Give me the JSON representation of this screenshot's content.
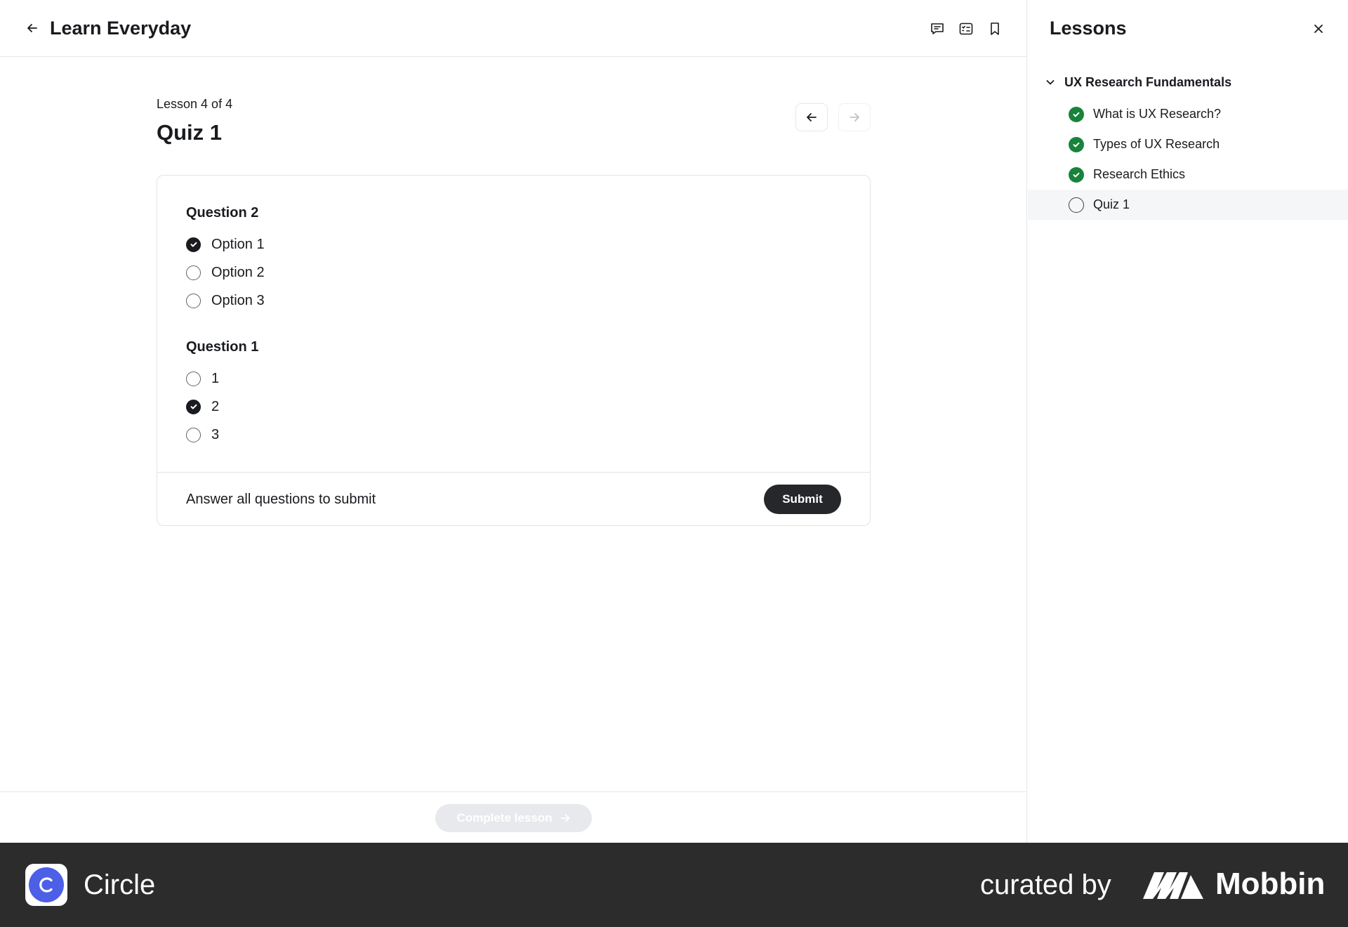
{
  "header": {
    "title": "Learn Everyday",
    "icons": [
      "back-arrow-icon",
      "comments-icon",
      "lesson-list-icon",
      "bookmark-icon"
    ]
  },
  "lesson": {
    "count_label": "Lesson 4 of 4",
    "title": "Quiz 1"
  },
  "quiz": {
    "questions": [
      {
        "title": "Question 2",
        "options": [
          {
            "label": "Option 1",
            "checked": true
          },
          {
            "label": "Option 2",
            "checked": false
          },
          {
            "label": "Option 3",
            "checked": false
          }
        ]
      },
      {
        "title": "Question 1",
        "options": [
          {
            "label": "1",
            "checked": false
          },
          {
            "label": "2",
            "checked": true
          },
          {
            "label": "3",
            "checked": false
          }
        ]
      }
    ],
    "footer_note": "Answer all questions to submit",
    "submit_label": "Submit"
  },
  "bottom": {
    "complete_label": "Complete lesson",
    "complete_enabled": false
  },
  "sidebar": {
    "title": "Lessons",
    "section": "UX Research Fundamentals",
    "lessons": [
      {
        "label": "What is UX Research?",
        "completed": true
      },
      {
        "label": "Types of UX Research",
        "completed": true
      },
      {
        "label": "Research Ethics",
        "completed": true
      },
      {
        "label": "Quiz 1",
        "completed": false,
        "active": true
      }
    ]
  },
  "branding": {
    "app_name": "Circle",
    "curated_by": "curated by",
    "curator": "Mobbin"
  },
  "colors": {
    "accent_dark": "#25272b",
    "completed_green": "#18833a",
    "circle_brand": "#4d5fe6",
    "footer_bg": "#2c2c2c"
  }
}
